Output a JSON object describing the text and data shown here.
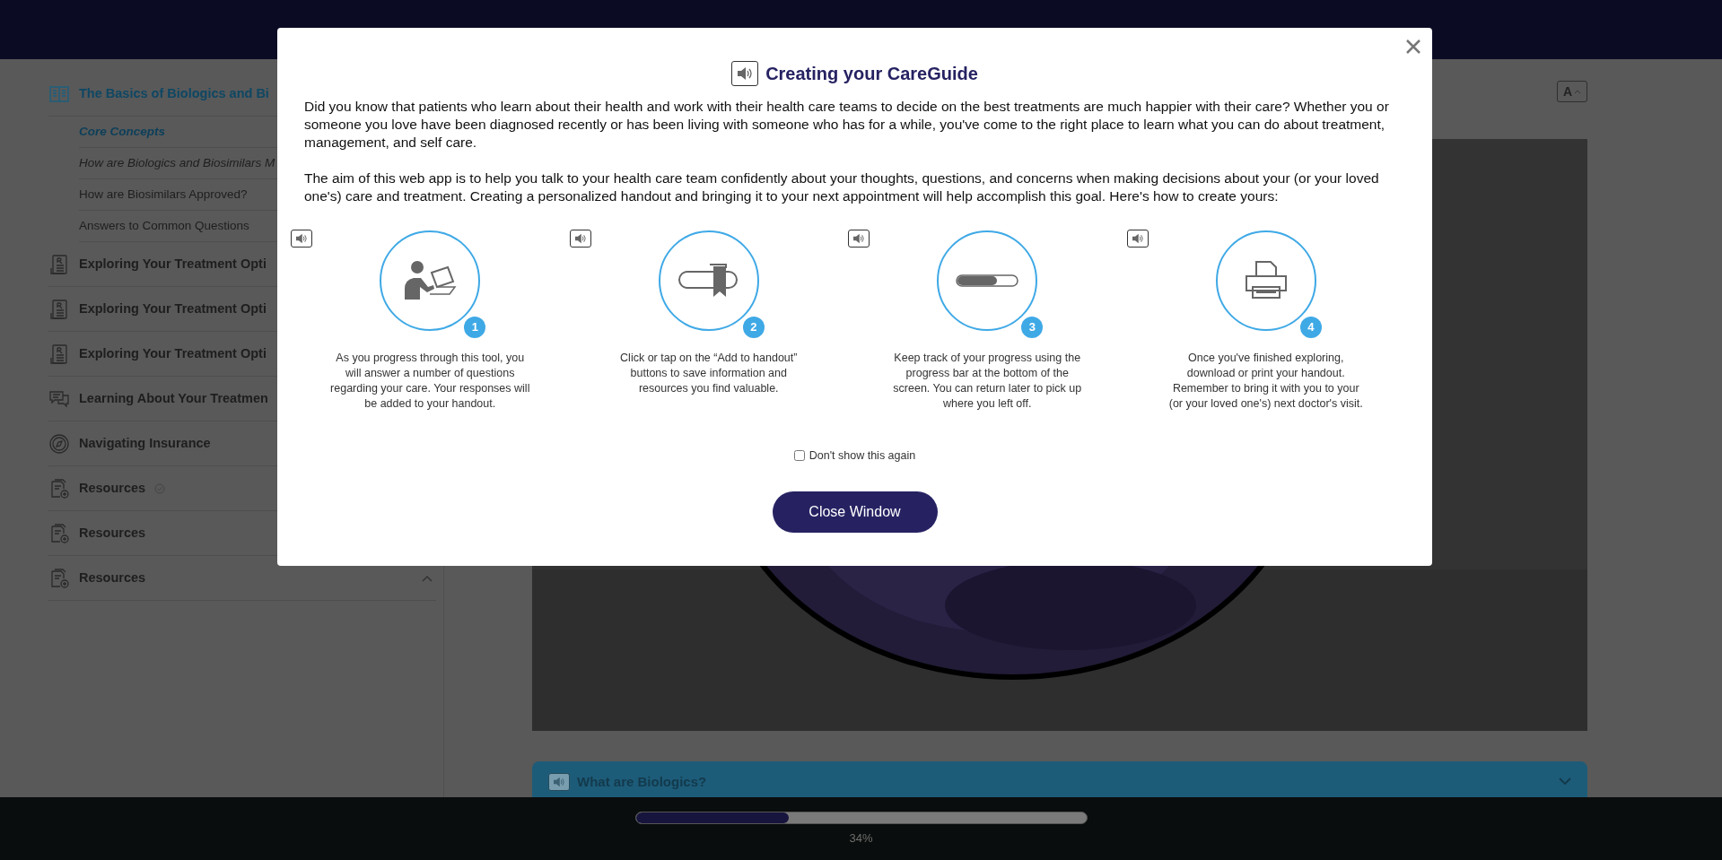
{
  "sidebar": {
    "items": [
      {
        "label": "The Basics of Biologics and Bi",
        "kind": "book",
        "selected": true,
        "children": [
          {
            "label": "Core Concepts",
            "selected": true,
            "italic": true
          },
          {
            "label": "How are Biologics and Biosimilars M",
            "selected": false,
            "italic": true
          },
          {
            "label": "How are Biosimilars Approved?",
            "selected": false,
            "italic": false
          },
          {
            "label": "Answers to Common Questions",
            "selected": false,
            "italic": false
          }
        ]
      },
      {
        "label": "Exploring Your Treatment Opti",
        "kind": "rx",
        "selected": false
      },
      {
        "label": "Exploring Your Treatment Opti",
        "kind": "rx",
        "selected": false
      },
      {
        "label": "Exploring Your Treatment Opti",
        "kind": "rx",
        "selected": false
      },
      {
        "label": "Learning About Your Treatmen",
        "kind": "chat",
        "selected": false
      },
      {
        "label": "Navigating Insurance",
        "kind": "compass",
        "selected": false
      },
      {
        "label": "Resources",
        "kind": "files",
        "selected": false,
        "done": true
      },
      {
        "label": "Resources",
        "kind": "files",
        "selected": false
      },
      {
        "label": "Resources",
        "kind": "files",
        "selected": false,
        "expanded": true
      }
    ]
  },
  "content": {
    "font_button": "A",
    "accordion": {
      "title": "What are Biologics?",
      "expanded": false
    }
  },
  "progress": {
    "level": 0.34,
    "reading": "34%"
  },
  "modal": {
    "title": "Creating your CareGuide",
    "paragraphs": [
      "Did you know that patients who learn about their health and work with their health care teams to decide on the best treatments are much happier with their care? Whether you or someone you love have been diagnosed recently or has been living with someone who has for a while, you've come to the right place to learn what you can do about treatment, management, and self care.",
      "The aim of this web app is to help you talk to your health care team confidently about your thoughts, questions, and concerns when making decisions about your (or your loved one's) care and treatment. Creating a personalized handout and bringing it to your next appointment will help accomplish this goal. Here's how to create yours:"
    ],
    "steps": [
      {
        "number": "1",
        "kind": "person",
        "text": "As you progress through this tool, you will answer a number of questions regarding your care. Your responses will be added to your handout."
      },
      {
        "number": "2",
        "kind": "bookmark",
        "text": "Click or tap on the “Add to handout” buttons to save information and resources you find valuable."
      },
      {
        "number": "3",
        "kind": "progress",
        "text": "Keep track of your progress using the progress bar at the bottom of the screen. You can return later to pick up where you left off."
      },
      {
        "number": "4",
        "kind": "printer",
        "text": "Once you've finished exploring, download or print your handout. Remember to bring it with you to your (or your loved one's) next doctor's visit."
      }
    ],
    "checkbox": {
      "label": "Don't show this again",
      "checked": false
    },
    "button": "Close Window"
  }
}
